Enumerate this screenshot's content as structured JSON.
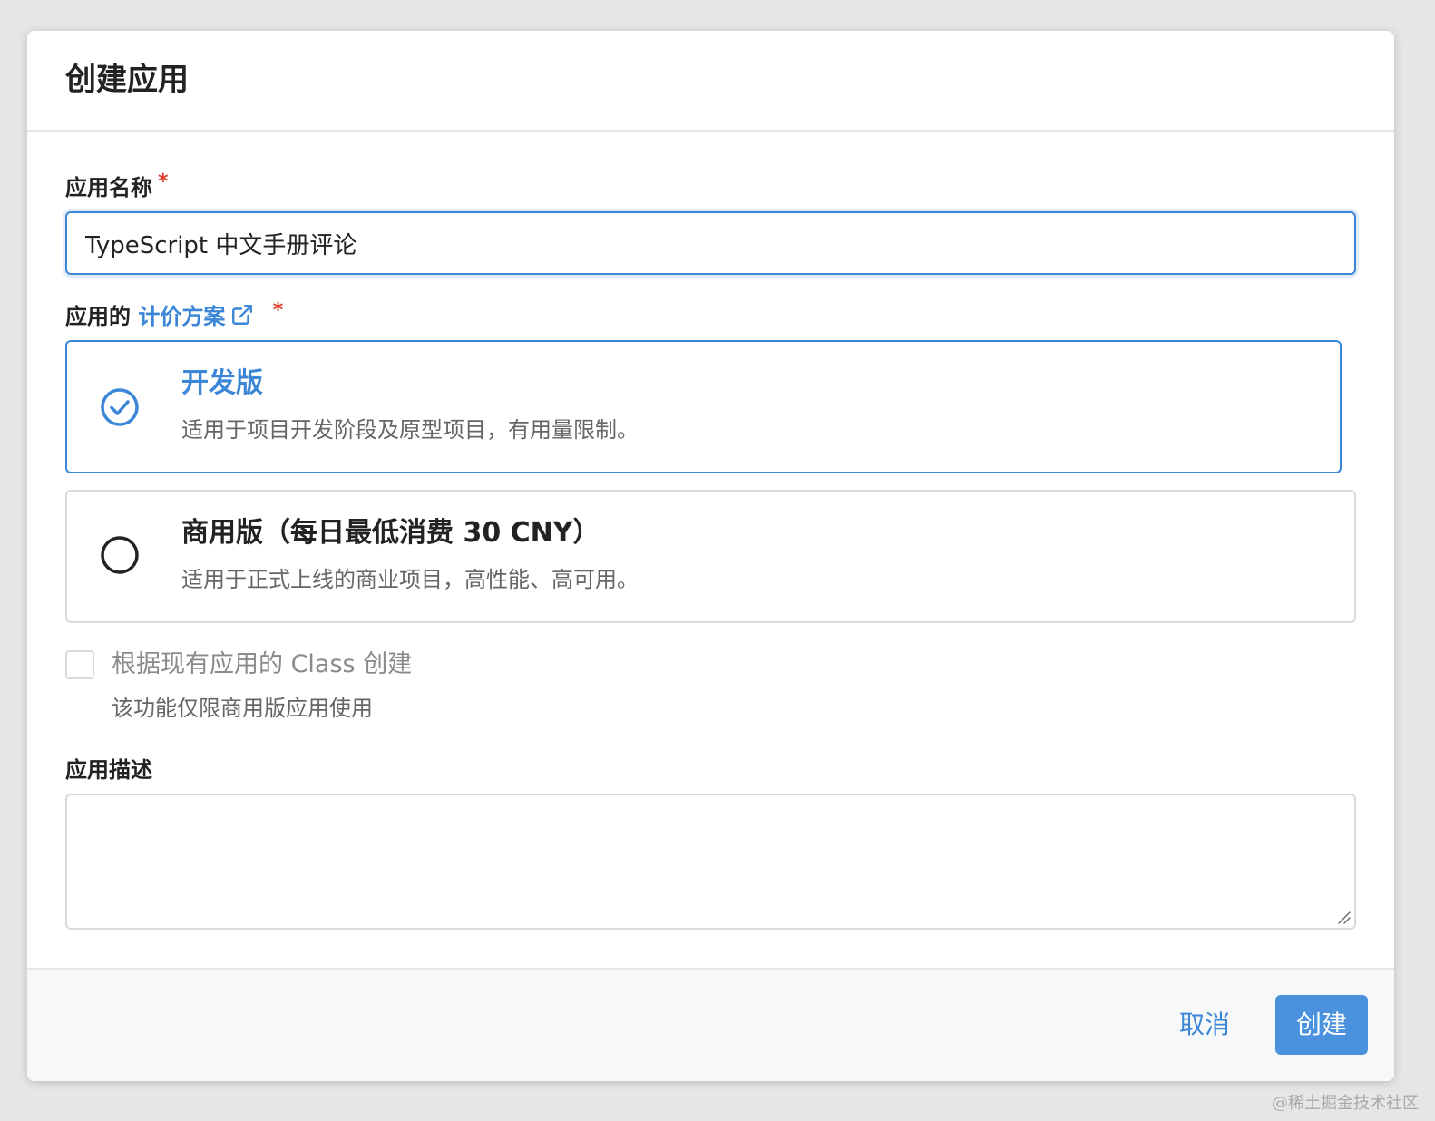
{
  "dialog": {
    "title": "创建应用"
  },
  "name_field": {
    "label": "应用名称",
    "required_mark": "*",
    "value": "TypeScript 中文手册评论"
  },
  "plan_field": {
    "label_prefix": "应用的",
    "link_text": "计价方案",
    "link_icon": "external-link-icon",
    "required_mark": "*",
    "options": [
      {
        "title": "开发版",
        "description": "适用于项目开发阶段及原型项目，有用量限制。",
        "selected": true,
        "icon": "check-circle-icon"
      },
      {
        "title": "商用版（每日最低消费 30 CNY）",
        "description": "适用于正式上线的商业项目，高性能、高可用。",
        "selected": false,
        "icon": "radio-circle-icon"
      }
    ]
  },
  "clone_option": {
    "label": "根据现有应用的 Class 创建",
    "hint": "该功能仅限商用版应用使用",
    "checked": false
  },
  "description_field": {
    "label": "应用描述",
    "value": ""
  },
  "footer": {
    "cancel_label": "取消",
    "create_label": "创建"
  },
  "watermark": "@稀土掘金技术社区",
  "colors": {
    "accent": "#3b86d6",
    "primary_button": "#4a92de",
    "required": "#e03b2c",
    "border": "#d9d9d9",
    "footer_bg": "#f7f8fa",
    "backdrop": "#e6e6e6"
  }
}
